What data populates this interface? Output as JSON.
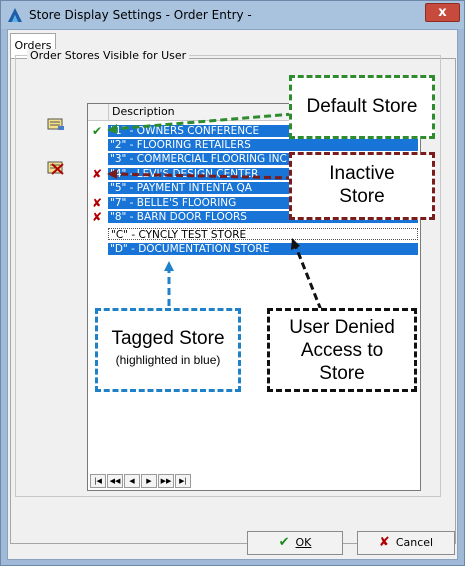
{
  "window": {
    "title": "Store Display Settings - Order Entry -",
    "close_glyph": "x"
  },
  "tabs": [
    {
      "label": "Orders"
    }
  ],
  "group": {
    "label": "Order Stores Visible for User"
  },
  "grid": {
    "column_header": "Description",
    "rows": [
      {
        "text": "\"1\" - OWNERS CONFERENCE",
        "state": "tagged",
        "mark": "default"
      },
      {
        "text": "\"2\" - FLOORING RETAILERS",
        "state": "tagged",
        "mark": ""
      },
      {
        "text": "\"3\" - COMMERCIAL FLOORING INC",
        "state": "tagged",
        "mark": ""
      },
      {
        "text": "\"4\" - LEVI'S DESIGN CENTER",
        "state": "tagged",
        "mark": "inactive"
      },
      {
        "text": "\"5\" - PAYMENT INTENTA QA",
        "state": "tagged",
        "mark": ""
      },
      {
        "text": "\"7\" - BELLE'S FLOORING",
        "state": "tagged",
        "mark": "inactive"
      },
      {
        "text": "\"8\" - BARN DOOR FLOORS",
        "state": "tagged",
        "mark": "inactive"
      },
      {
        "text": "\"C\" - CYNCLY TEST STORE",
        "state": "untagged",
        "mark": ""
      },
      {
        "text": "\"D\" - DOCUMENTATION STORE",
        "state": "tagged",
        "mark": ""
      }
    ],
    "nav_buttons": [
      "|◀",
      "◀◀",
      "◀",
      "▶",
      "▶▶",
      "▶|"
    ]
  },
  "callouts": {
    "default_store": "Default Store",
    "inactive_store_line1": "Inactive",
    "inactive_store_line2": "Store",
    "tagged_store": "Tagged Store",
    "tagged_store_note": "(highlighted in blue)",
    "denied_line1": "User Denied",
    "denied_line2": "Access to",
    "denied_line3": "Store"
  },
  "buttons": {
    "ok": "OK",
    "cancel": "Cancel"
  },
  "colors": {
    "tagged_row": "#1874d6",
    "default_callout": "#2e8b2e",
    "inactive_callout": "#7b1c1c",
    "tagged_callout": "#1f82c9",
    "denied_callout": "#111111"
  },
  "icons": {
    "side_icon_1": "tag-list-icon",
    "side_icon_2": "inactive-list-icon",
    "default_mark": "checkmark-icon",
    "inactive_mark": "red-x-icon"
  }
}
